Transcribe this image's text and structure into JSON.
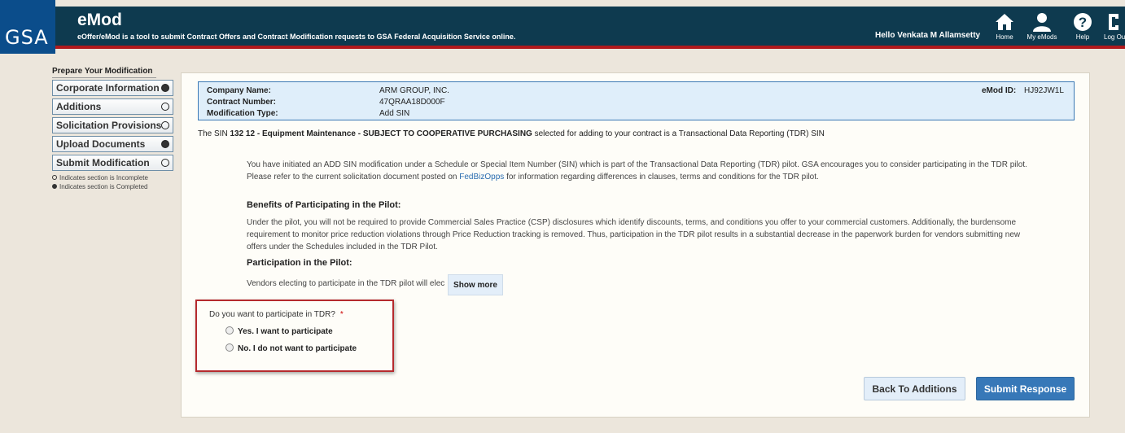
{
  "header": {
    "logo_text": "GSA",
    "title": "eMod",
    "subtitle": "eOffer/eMod is a tool to submit Contract Offers and Contract Modification requests to GSA Federal Acquisition Service online.",
    "greeting": "Hello Venkata M Allamsetty",
    "nav": {
      "home": "Home",
      "my_emods": "My eMods",
      "help": "Help",
      "logout": "Log Out"
    }
  },
  "sidebar": {
    "heading": "Prepare Your Modification",
    "items": [
      {
        "label": "Corporate Information",
        "status": "completed"
      },
      {
        "label": "Additions",
        "status": "incomplete"
      },
      {
        "label": "Solicitation Provisions",
        "status": "incomplete"
      },
      {
        "label": "Upload Documents",
        "status": "completed"
      },
      {
        "label": "Submit Modification",
        "status": "incomplete"
      }
    ],
    "legend": {
      "incomplete": "Indicates section is Incomplete",
      "completed": "Indicates section is Completed"
    }
  },
  "info": {
    "company_label": "Company Name:",
    "company_value": "ARM GROUP, INC.",
    "contract_label": "Contract Number:",
    "contract_value": "47QRAA18D000F",
    "modtype_label": "Modification Type:",
    "modtype_value": "Add SIN",
    "emod_label": "eMod ID:",
    "emod_value": "HJ92JW1L"
  },
  "sin_notice": {
    "prefix": "The SIN ",
    "sin": "132 12 - Equipment Maintenance - SUBJECT TO COOPERATIVE PURCHASING",
    "suffix": " selected for adding to your contract is a Transactional Data Reporting (TDR) SIN"
  },
  "intro": {
    "part1": "You have initiated an ADD SIN modification under a Schedule or Special Item Number (SIN) which is part of the Transactional Data Reporting (TDR) pilot.  GSA encourages you to consider participating in the TDR pilot.  Please refer to the current solicitation document posted on ",
    "link": "FedBizOpps",
    "part2": " for information regarding differences in clauses, terms and conditions for the TDR pilot."
  },
  "benefits": {
    "heading": "Benefits of Participating in the Pilot:",
    "text": "Under the pilot, you will not be required to provide Commercial Sales Practice (CSP) disclosures which identify discounts, terms, and conditions you offer to your commercial customers.  Additionally, the burdensome requirement to monitor price reduction violations through Price Reduction tracking is removed.  Thus, participation in the TDR pilot results in a substantial decrease in the paperwork burden for vendors submitting new offers under the Schedules included in the TDR Pilot."
  },
  "participation": {
    "heading": "Participation in the Pilot:",
    "text": "Vendors electing to participate in the TDR pilot will elec",
    "show_more": "Show more"
  },
  "tdr_question": {
    "question": "Do you want to participate in TDR?",
    "required_mark": "*",
    "yes": "Yes. I want to participate",
    "no": "No. I do not want to participate"
  },
  "buttons": {
    "back": "Back To Additions",
    "submit": "Submit Response"
  },
  "colors": {
    "header_bg": "#0e3a4f",
    "header_stripe": "#b0191c",
    "logo_bg": "#0b4d8b",
    "primary_button": "#3778b8",
    "highlight_border": "#b52a2e"
  }
}
